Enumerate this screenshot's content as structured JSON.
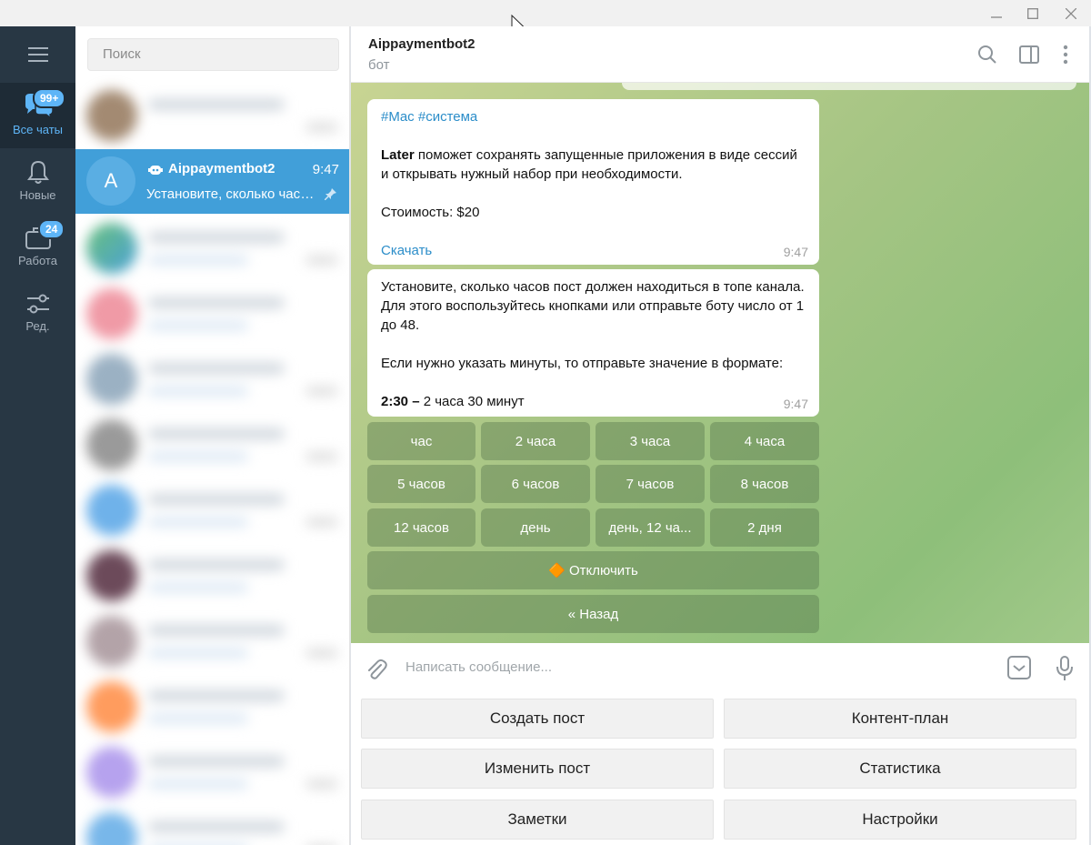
{
  "window": {
    "minimize_icon": "minimize-icon",
    "maximize_icon": "maximize-icon",
    "close_icon": "close-icon"
  },
  "rail": {
    "folders": [
      {
        "label": "Все чаты",
        "badge": "99+",
        "icon": "chats-icon",
        "active": true
      },
      {
        "label": "Новые",
        "badge": "",
        "icon": "bell-icon",
        "active": false
      },
      {
        "label": "Работа",
        "badge": "24",
        "icon": "briefcase-icon",
        "active": false
      },
      {
        "label": "Ред.",
        "badge": "",
        "icon": "sliders-icon",
        "active": false
      }
    ]
  },
  "sidebar": {
    "search_placeholder": "Поиск",
    "active_chat": {
      "avatar_letter": "A",
      "name": "Aippaymentbot2",
      "time": "9:47",
      "preview": "Установите, сколько часов пост должен находиться в топе канала"
    }
  },
  "chat": {
    "title": "Aippaymentbot2",
    "status": "бот",
    "messages": [
      {
        "tags": "#Mac #система",
        "app_name": "Later",
        "text": " поможет сохранять запущенные приложения в виде сессий и открывать нужный набор при необходимости.",
        "price": "Стоимость: $20",
        "link": "Скачать",
        "time": "9:47"
      },
      {
        "line1": "Установите, сколько часов пост должен находиться в топе канала. Для этого воспользуйтесь кнопками или отправьте боту число от 1 до 48.",
        "line2": "Если нужно указать минуты, то отправьте значение в формате:",
        "example_bold": "2:30 –",
        "example_rest": " 2 часа 30 минут",
        "time": "9:47"
      }
    ],
    "inline_keyboard": {
      "rows": [
        [
          "час",
          "2 часа",
          "3 часа",
          "4 часа"
        ],
        [
          "5 часов",
          "6 часов",
          "7 часов",
          "8 часов"
        ],
        [
          "12 часов",
          "день",
          "день, 12 ча...",
          "2 дня"
        ]
      ],
      "disable": "🔶 Отключить",
      "back": "« Назад"
    },
    "composer_placeholder": "Написать сообщение...",
    "reply_keyboard": [
      "Создать пост",
      "Контент-план",
      "Изменить пост",
      "Статистика",
      "Заметки",
      "Настройки"
    ]
  },
  "colors": {
    "accent": "#419fd9",
    "rail_bg": "#283744",
    "rail_active": "#5eb5f7"
  }
}
